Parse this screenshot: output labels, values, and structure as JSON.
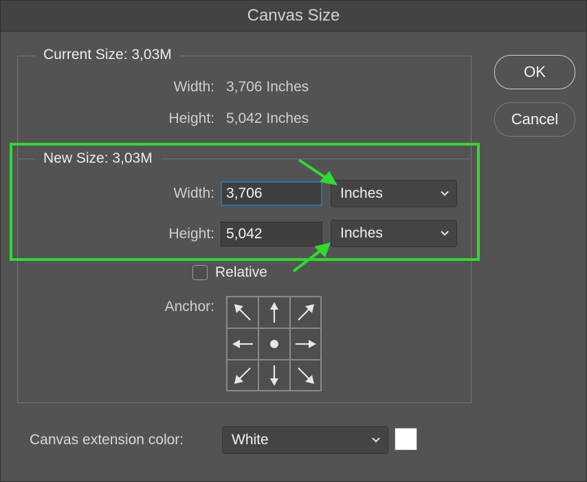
{
  "dialog": {
    "title": "Canvas Size"
  },
  "current_size": {
    "legend": "Current Size: 3,03M",
    "width_label": "Width:",
    "width_value": "3,706 Inches",
    "height_label": "Height:",
    "height_value": "5,042 Inches"
  },
  "new_size": {
    "legend": "New Size: 3,03M",
    "width_label": "Width:",
    "width_value": "3,706",
    "width_unit": "Inches",
    "height_label": "Height:",
    "height_value": "5,042",
    "height_unit": "Inches",
    "relative_label": "Relative",
    "relative_checked": false,
    "anchor_label": "Anchor:",
    "anchor_grid": [
      "arrow-up-left-icon",
      "arrow-up-icon",
      "arrow-up-right-icon",
      "arrow-left-icon",
      "center-dot-icon",
      "arrow-right-icon",
      "arrow-down-left-icon",
      "arrow-down-icon",
      "arrow-down-right-icon"
    ]
  },
  "extension": {
    "label": "Canvas extension color:",
    "value": "White",
    "swatch_color": "#ffffff"
  },
  "buttons": {
    "ok": "OK",
    "cancel": "Cancel"
  },
  "colors": {
    "annotation_green": "#2edb2e",
    "focus_blue": "#2f6db5",
    "dialog_bg": "#535353"
  }
}
